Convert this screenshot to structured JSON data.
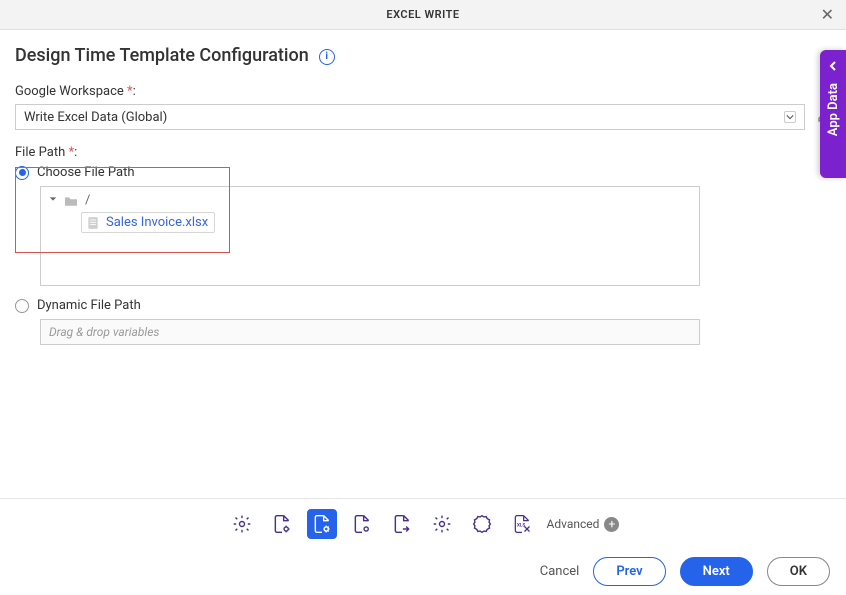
{
  "header": {
    "title": "EXCEL WRITE"
  },
  "page": {
    "title": "Design Time Template Configuration"
  },
  "fields": {
    "google_workspace": {
      "label": "Google Workspace",
      "value": "Write Excel Data (Global)"
    },
    "file_path": {
      "label": "File Path",
      "choose_label": "Choose File Path",
      "dynamic_label": "Dynamic File Path",
      "root": "/",
      "selected_file": "Sales Invoice.xlsx",
      "dynamic_placeholder": "Drag & drop variables"
    }
  },
  "toolbar": {
    "advanced": "Advanced"
  },
  "footer": {
    "cancel": "Cancel",
    "prev": "Prev",
    "next": "Next",
    "ok": "OK"
  },
  "side": {
    "app_data": "App Data"
  }
}
